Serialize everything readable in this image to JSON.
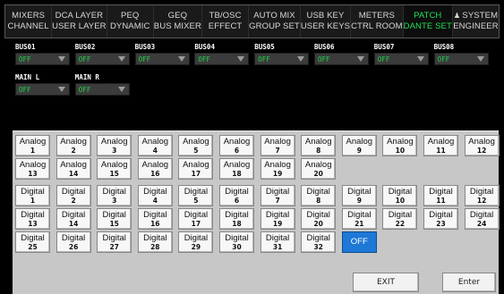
{
  "tabs": [
    {
      "line1": "MIXERS",
      "line2": "CHANNEL",
      "active": false
    },
    {
      "line1": "DCA LAYER",
      "line2": "USER LAYER",
      "active": false
    },
    {
      "line1": "PEQ",
      "line2": "DYNAMIC",
      "active": false
    },
    {
      "line1": "GEQ",
      "line2": "BUS MIXER",
      "active": false
    },
    {
      "line1": "TB/OSC",
      "line2": "EFFECT",
      "active": false
    },
    {
      "line1": "AUTO MIX",
      "line2": "GROUP SET",
      "active": false
    },
    {
      "line1": "USB KEY",
      "line2": "USER KEYS",
      "active": false
    },
    {
      "line1": "METERS",
      "line2": "CTRL ROOM",
      "active": false
    },
    {
      "line1": "PATCH",
      "line2": "DANTE SET",
      "active": true
    },
    {
      "line1": "SYSTEM",
      "line2": "ENGINEER",
      "active": false,
      "icon": "user-icon"
    }
  ],
  "buses": [
    {
      "name": "BUS01",
      "value": "OFF"
    },
    {
      "name": "BUS02",
      "value": "OFF"
    },
    {
      "name": "BUS03",
      "value": "OFF"
    },
    {
      "name": "BUS04",
      "value": "OFF"
    },
    {
      "name": "BUS05",
      "value": "OFF"
    },
    {
      "name": "BUS06",
      "value": "OFF"
    },
    {
      "name": "BUS07",
      "value": "OFF"
    },
    {
      "name": "BUS08",
      "value": "OFF"
    },
    {
      "name": "MAIN L",
      "value": "OFF"
    },
    {
      "name": "MAIN R",
      "value": "OFF"
    }
  ],
  "sources": {
    "analog_label": "Analog",
    "analog_count": 20,
    "digital_label": "Digital",
    "digital_count": 32,
    "off_label": "OFF"
  },
  "actions": {
    "exit_label": "EXIT",
    "enter_label": "Enter"
  },
  "colors": {
    "active_tab": "#21e05a",
    "bus_value": "#1fd04a",
    "off_button": "#1e78d6",
    "grid_background": "#c7c7c7"
  }
}
